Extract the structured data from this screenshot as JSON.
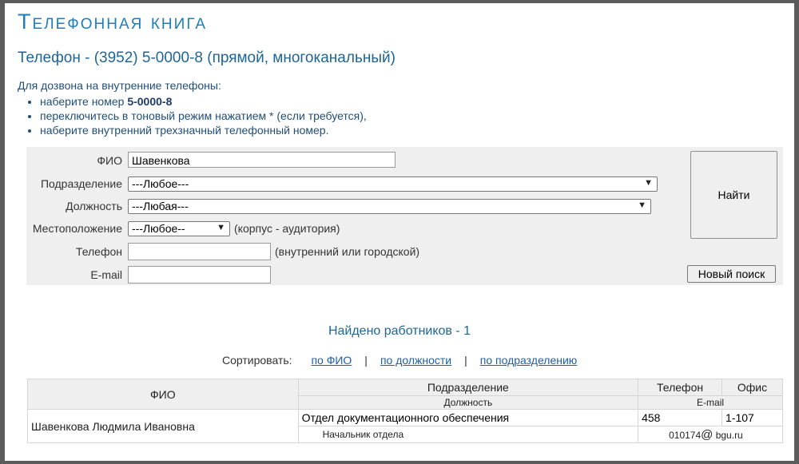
{
  "page": {
    "title": "Телефонная книга",
    "subtitle": "Телефон - (3952) 5-0000-8 (прямой, многоканальный)",
    "intro": "Для дозвона на внутренние телефоны:",
    "instructions": {
      "step1_prefix": "наберите номер ",
      "step1_number": "5-0000-8",
      "step2": "переключитесь в тоновый режим нажатием * (если требуется),",
      "step3": "наберите внутренний трехзначный телефонный номер."
    }
  },
  "search": {
    "fio_label": "ФИО",
    "fio_value": "Шавенкова",
    "department_label": "Подразделение",
    "department_value": "---Любое---",
    "position_label": "Должность",
    "position_value": "---Любая---",
    "location_label": "Местоположение",
    "location_value": "---Любое--",
    "location_hint": "(корпус - аудитория)",
    "phone_label": "Телефон",
    "phone_value": "",
    "phone_hint": "(внутренний или городской)",
    "email_label": "E-mail",
    "email_value": "",
    "find_button": "Найти",
    "new_search_button": "Новый поиск"
  },
  "results": {
    "found_text": "Найдено работников - 1",
    "sort_label": "Сортировать:",
    "sort_options": [
      "по ФИО",
      "по должности",
      "по подразделению"
    ],
    "sort_separator": "|",
    "headers": {
      "fio": "ФИО",
      "department": "Подразделение",
      "position": "Должность",
      "phone": "Телефон",
      "office": "Офис",
      "email": "E-mail"
    },
    "rows": [
      {
        "fio": "Шавенкова Людмила Ивановна",
        "department": "Отдел документационного обеспечения",
        "position": "Начальник отдела",
        "phone": "458",
        "office": "1-107",
        "email_user": "010174",
        "email_at": "@",
        "email_domain": " bgu.ru"
      }
    ]
  },
  "icons": {
    "select_arrow": "chevron-down-icon"
  }
}
